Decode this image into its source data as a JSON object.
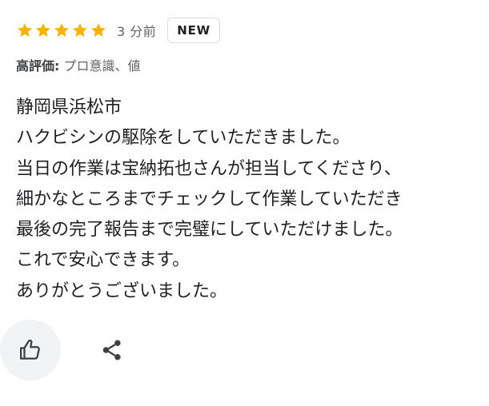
{
  "review": {
    "rating": 5,
    "rating_max": 5,
    "star_color": "#F4B400",
    "time_ago": "3 分前",
    "badge": "NEW",
    "highlights": {
      "label": "高評価:",
      "value": " プロ意識、値"
    },
    "body_lines": [
      "静岡県浜松市",
      "ハクビシンの駆除をしていただきました。",
      "当日の作業は宝納拓也さんが担当してくださり、",
      "細かなところまでチェックして作業していただき",
      "最後の完了報告まで完璧にしていただけました。",
      "これで安心できます。",
      "ありがとうございました。"
    ]
  },
  "actions": {
    "like_icon": "thumb-up-icon",
    "share_icon": "share-icon"
  },
  "colors": {
    "text_primary": "#202124",
    "text_secondary": "#5f6368",
    "like_button_bg": "#f1f3f4",
    "badge_border": "#dadce0"
  }
}
